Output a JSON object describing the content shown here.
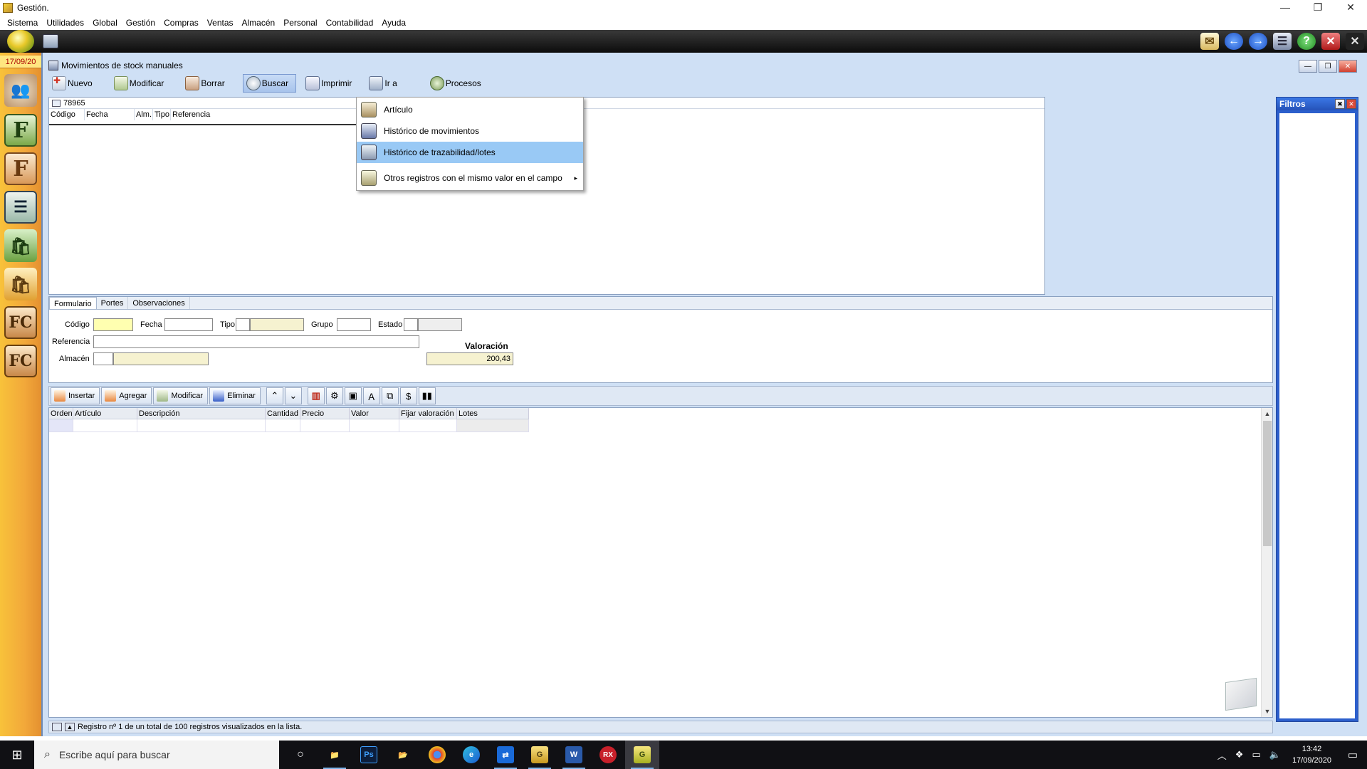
{
  "window": {
    "title": "Gestión.",
    "controls": {
      "minimize": "—",
      "restore": "❐",
      "close": "✕"
    }
  },
  "menu": [
    "Sistema",
    "Utilidades",
    "Global",
    "Gestión",
    "Compras",
    "Ventas",
    "Almacén",
    "Personal",
    "Contabilidad",
    "Ayuda"
  ],
  "sidebar": {
    "date": "17/09/20",
    "tiles": [
      {
        "name": "users",
        "glyph": "👥"
      },
      {
        "name": "f1",
        "glyph": "F"
      },
      {
        "name": "f2",
        "glyph": "F"
      },
      {
        "name": "list",
        "glyph": "☰"
      },
      {
        "name": "bag1",
        "glyph": "🛍"
      },
      {
        "name": "bag2",
        "glyph": "🛍"
      },
      {
        "name": "fc1",
        "glyph": "FC"
      },
      {
        "name": "fc2",
        "glyph": "FC"
      }
    ]
  },
  "document": {
    "title": "Movimientos de stock manuales",
    "mdi_controls": {
      "minimize": "—",
      "restore": "❐",
      "close": "✕"
    }
  },
  "toolbar": {
    "nuevo": "Nuevo",
    "modificar": "Modificar",
    "borrar": "Borrar",
    "buscar": "Buscar",
    "imprimir": "Imprimir",
    "ir_a": "Ir a",
    "procesos": "Procesos"
  },
  "grid": {
    "search_value": "78965",
    "columns": [
      "Código",
      "Fecha",
      "Alm.",
      "Tipo",
      "Referencia"
    ]
  },
  "dropdown": {
    "items": [
      {
        "label": "Artículo",
        "selected": false,
        "submenu": false
      },
      {
        "label": "Histórico de movimientos",
        "selected": false,
        "submenu": false
      },
      {
        "label": "Histórico de trazabilidad/lotes",
        "selected": true,
        "submenu": false
      },
      {
        "label": "Otros registros con el mismo valor en el campo",
        "selected": false,
        "submenu": true
      }
    ],
    "submenu_arrow": "▸"
  },
  "filters": {
    "title": "Filtros",
    "pin": "✖",
    "close": "✕"
  },
  "form": {
    "tabs": [
      "Formulario",
      "Portes",
      "Observaciones"
    ],
    "labels": {
      "codigo": "Código",
      "fecha": "Fecha",
      "tipo": "Tipo",
      "grupo": "Grupo",
      "estado": "Estado",
      "referencia": "Referencia",
      "almacen": "Almacén",
      "valoracion": "Valoración"
    },
    "values": {
      "codigo": "",
      "fecha": "",
      "tipo": "",
      "grupo": "",
      "estado": "",
      "referencia": "",
      "almacen": "",
      "valoracion": "200,43"
    }
  },
  "detail_toolbar": {
    "insertar": "Insertar",
    "agregar": "Agregar",
    "modificar": "Modificar",
    "eliminar": "Eliminar",
    "up": "⌃",
    "down": "⌄"
  },
  "detail_grid": {
    "columns": [
      "Orden",
      "Artículo",
      "Descripción",
      "Cantidad",
      "Precio",
      "Valor",
      "Fijar valoración",
      "Lotes"
    ],
    "scroll_up": "▲",
    "scroll_down": "▼"
  },
  "status": {
    "text": "Registro nº 1 de un total de 100 registros visualizados en la lista."
  },
  "taskbar": {
    "search_placeholder": "Escribe aquí para buscar",
    "time": "13:42",
    "date": "17/09/2020",
    "apps": [
      {
        "name": "cortana",
        "label": "○",
        "color": "#101014"
      },
      {
        "name": "explorer",
        "label": "📁",
        "color": "#e8b830"
      },
      {
        "name": "photoshop",
        "label": "Ps",
        "color": "#0c1e3c"
      },
      {
        "name": "folder",
        "label": "📂",
        "color": "#e8c040"
      },
      {
        "name": "chrome",
        "label": "●",
        "color": "#d84030"
      },
      {
        "name": "edge",
        "label": "e",
        "color": "#1a7fd8"
      },
      {
        "name": "teamviewer",
        "label": "⇄",
        "color": "#1a6ad8"
      },
      {
        "name": "gestion-2",
        "label": "G",
        "color": "#d8b830"
      },
      {
        "name": "word",
        "label": "W",
        "color": "#2a5aaa"
      },
      {
        "name": "rx",
        "label": "RX",
        "color": "#c8202a"
      },
      {
        "name": "gestion",
        "label": "G",
        "color": "#c8b030"
      }
    ]
  }
}
